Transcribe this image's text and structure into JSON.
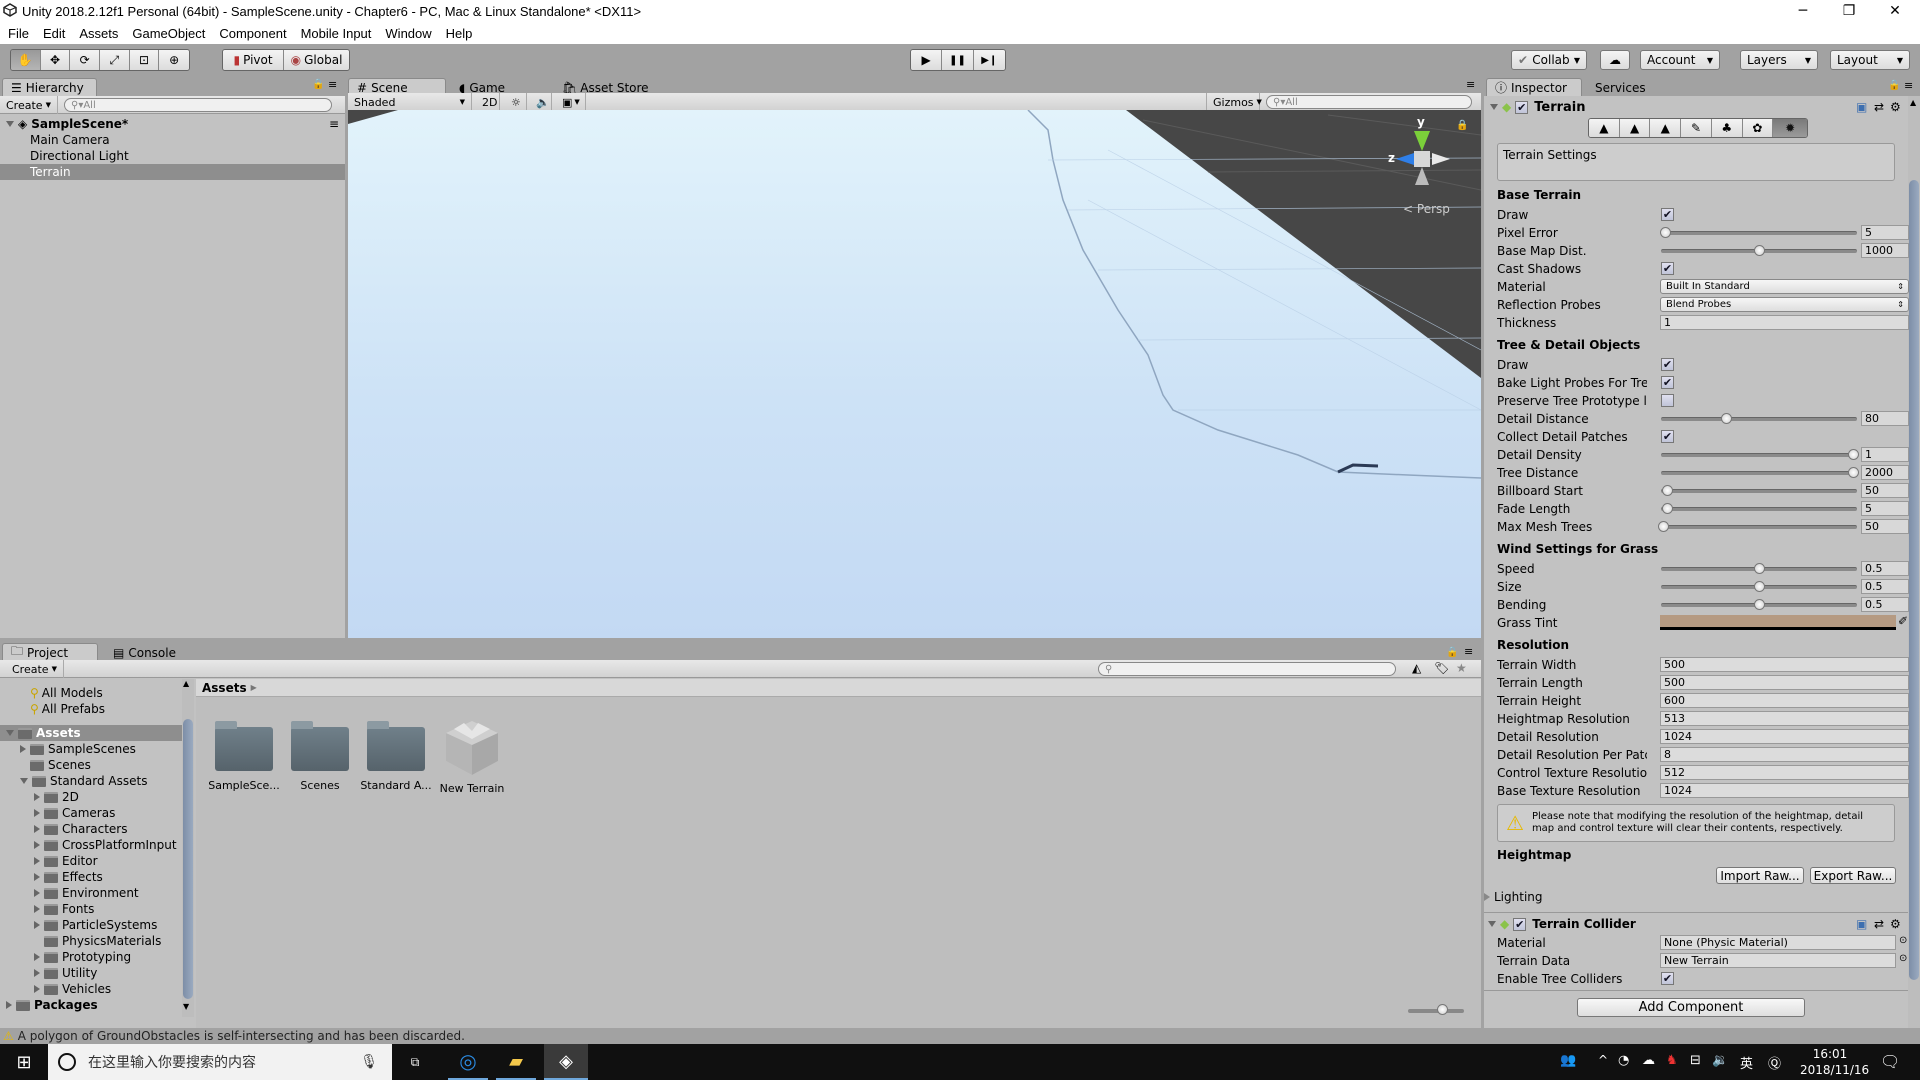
{
  "window": {
    "title": "Unity 2018.2.12f1 Personal (64bit) - SampleScene.unity - Chapter6 - PC, Mac & Linux Standalone* <DX11>",
    "controls": {
      "minimize": "─",
      "maximize": "❐",
      "close": "✕"
    }
  },
  "menu": [
    "File",
    "Edit",
    "Assets",
    "GameObject",
    "Component",
    "Mobile Input",
    "Window",
    "Help"
  ],
  "toolbar": {
    "tools": [
      "hand-tool",
      "move-tool",
      "rotate-tool",
      "scale-tool",
      "rect-tool",
      "transform-tool"
    ],
    "tool_glyphs": [
      "✋",
      "✥",
      "⟳",
      "⤢",
      "⊡",
      "⊕"
    ],
    "pivot": "Pivot",
    "global": "Global",
    "play": "▶",
    "pause": "❚❚",
    "step": "▶❙",
    "collab": "Collab",
    "account": "Account",
    "layers": "Layers",
    "layout": "Layout"
  },
  "hierarchy": {
    "tab": "Hierarchy",
    "create": "Create",
    "search_placeholder": "All",
    "scene": "SampleScene*",
    "items": [
      "Main Camera",
      "Directional Light",
      "Terrain"
    ],
    "selected": "Terrain"
  },
  "scene": {
    "tabs": [
      "Scene",
      "Game",
      "Asset Store"
    ],
    "shading": "Shaded",
    "mode_2d": "2D",
    "gizmos": "Gizmos",
    "search_placeholder": "All",
    "projection": "Persp",
    "axis_labels": {
      "y": "y",
      "z": "z"
    }
  },
  "project": {
    "tabs": [
      "Project",
      "Console"
    ],
    "create": "Create",
    "favorites": [
      "All Models",
      "All Prefabs"
    ],
    "tree": [
      {
        "label": "Assets",
        "level": 0,
        "expand": "down",
        "bold": true,
        "selected": true
      },
      {
        "label": "SampleScenes",
        "level": 1,
        "expand": "right"
      },
      {
        "label": "Scenes",
        "level": 1,
        "expand": "none"
      },
      {
        "label": "Standard Assets",
        "level": 1,
        "expand": "down"
      },
      {
        "label": "2D",
        "level": 2,
        "expand": "right"
      },
      {
        "label": "Cameras",
        "level": 2,
        "expand": "right"
      },
      {
        "label": "Characters",
        "level": 2,
        "expand": "right"
      },
      {
        "label": "CrossPlatformInput",
        "level": 2,
        "expand": "right"
      },
      {
        "label": "Editor",
        "level": 2,
        "expand": "right"
      },
      {
        "label": "Effects",
        "level": 2,
        "expand": "right"
      },
      {
        "label": "Environment",
        "level": 2,
        "expand": "right"
      },
      {
        "label": "Fonts",
        "level": 2,
        "expand": "right"
      },
      {
        "label": "ParticleSystems",
        "level": 2,
        "expand": "right"
      },
      {
        "label": "PhysicsMaterials",
        "level": 2,
        "expand": "none"
      },
      {
        "label": "Prototyping",
        "level": 2,
        "expand": "right"
      },
      {
        "label": "Utility",
        "level": 2,
        "expand": "right"
      },
      {
        "label": "Vehicles",
        "level": 2,
        "expand": "right"
      },
      {
        "label": "Packages",
        "level": 0,
        "expand": "right",
        "bold": true
      }
    ],
    "breadcrumb": "Assets",
    "assets": [
      {
        "label": "SampleSce...",
        "type": "folder"
      },
      {
        "label": "Scenes",
        "type": "folder"
      },
      {
        "label": "Standard A...",
        "type": "folder"
      },
      {
        "label": "New Terrain",
        "type": "terrain"
      }
    ],
    "zoom_level": 0.6
  },
  "inspector": {
    "tabs": [
      "Inspector",
      "Services"
    ],
    "component": "Terrain",
    "enabled": true,
    "tool_icons": [
      "raise-lower-terrain",
      "paint-height",
      "smooth-height",
      "paint-texture",
      "place-trees",
      "paint-details",
      "terrain-settings"
    ],
    "tool_glyphs": [
      "▲",
      "▲",
      "▲",
      "✎",
      "♣",
      "✿",
      "✹"
    ],
    "settings_title": "Terrain Settings",
    "base_terrain": {
      "title": "Base Terrain",
      "draw": {
        "label": "Draw",
        "checked": true
      },
      "pixel_error": {
        "label": "Pixel Error",
        "value": "5",
        "fraction": 0.02
      },
      "base_map_dist": {
        "label": "Base Map Dist.",
        "value": "1000",
        "fraction": 0.5
      },
      "cast_shadows": {
        "label": "Cast Shadows",
        "checked": true
      },
      "material": {
        "label": "Material",
        "value": "Built In Standard"
      },
      "reflection_probes": {
        "label": "Reflection Probes",
        "value": "Blend Probes"
      },
      "thickness": {
        "label": "Thickness",
        "value": "1"
      }
    },
    "tree_detail": {
      "title": "Tree & Detail Objects",
      "draw": {
        "label": "Draw",
        "checked": true
      },
      "bake_light_probes": {
        "label": "Bake Light Probes For Tre",
        "checked": true
      },
      "preserve_tree": {
        "label": "Preserve Tree Prototype l",
        "checked": false
      },
      "detail_distance": {
        "label": "Detail Distance",
        "value": "80",
        "fraction": 0.33
      },
      "collect_patches": {
        "label": "Collect Detail Patches",
        "checked": true
      },
      "detail_density": {
        "label": "Detail Density",
        "value": "1",
        "fraction": 0.98
      },
      "tree_distance": {
        "label": "Tree Distance",
        "value": "2000",
        "fraction": 0.98
      },
      "billboard_start": {
        "label": "Billboard Start",
        "value": "50",
        "fraction": 0.03
      },
      "fade_length": {
        "label": "Fade Length",
        "value": "5",
        "fraction": 0.03
      },
      "max_mesh_trees": {
        "label": "Max Mesh Trees",
        "value": "50",
        "fraction": 0.01
      }
    },
    "wind": {
      "title": "Wind Settings for Grass",
      "speed": {
        "label": "Speed",
        "value": "0.5",
        "fraction": 0.5
      },
      "size": {
        "label": "Size",
        "value": "0.5",
        "fraction": 0.5
      },
      "bending": {
        "label": "Bending",
        "value": "0.5",
        "fraction": 0.5
      },
      "grass_tint": {
        "label": "Grass Tint",
        "color": "#b59a82"
      }
    },
    "resolution": {
      "title": "Resolution",
      "fields": [
        {
          "label": "Terrain Width",
          "value": "500"
        },
        {
          "label": "Terrain Length",
          "value": "500"
        },
        {
          "label": "Terrain Height",
          "value": "600"
        },
        {
          "label": "Heightmap Resolution",
          "value": "513"
        },
        {
          "label": "Detail Resolution",
          "value": "1024"
        },
        {
          "label": "Detail Resolution Per Patc",
          "value": "8"
        },
        {
          "label": "Control Texture Resolutio",
          "value": "512"
        },
        {
          "label": "Base Texture Resolution",
          "value": "1024"
        }
      ],
      "warning": "Please note that modifying the resolution of the heightmap, detail map and control texture will clear their contents, respectively."
    },
    "heightmap": {
      "title": "Heightmap",
      "import": "Import Raw...",
      "export": "Export Raw..."
    },
    "lighting": "Lighting",
    "collider": {
      "title": "Terrain Collider",
      "enabled": true,
      "material": {
        "label": "Material",
        "value": "None (Physic Material)"
      },
      "terrain_data": {
        "label": "Terrain Data",
        "value": "New Terrain"
      },
      "tree_colliders": {
        "label": "Enable Tree Colliders",
        "checked": true
      }
    },
    "add_component": "Add Component"
  },
  "status": "A polygon of GroundObstacles is self-intersecting and has been discarded.",
  "taskbar": {
    "search_placeholder": "在这里输入你要搜索的内容",
    "tray_lang": "英",
    "time": "16:01",
    "date": "2018/11/16"
  }
}
